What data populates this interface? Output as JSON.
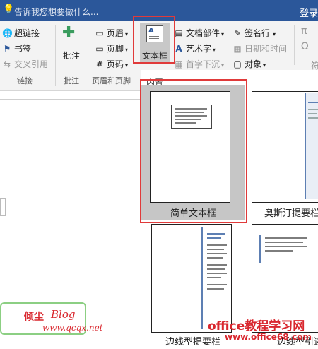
{
  "title_bar": {
    "tell_me_placeholder": "告诉我您想要做什么...",
    "login": "登录"
  },
  "ribbon": {
    "links_group": {
      "items": [
        "超链接",
        "书签",
        "交叉引用"
      ],
      "label": "链接"
    },
    "comments_group": {
      "item": "批注",
      "label": "批注"
    },
    "header_footer_group": {
      "items": [
        "页眉",
        "页脚",
        "页码"
      ],
      "label": "页眉和页脚"
    },
    "text_group": {
      "textbox": "文本框",
      "quick_parts": "文档部件",
      "wordart": "艺术字",
      "drop_cap": "首字下沉",
      "signature_line": "签名行",
      "date_time": "日期和时间",
      "object": "对象"
    },
    "symbols_group": {
      "pi": "π",
      "omega": "Ω",
      "more": "符"
    }
  },
  "gallery": {
    "header": "内置",
    "tiles": [
      {
        "label": "简单文本框",
        "selected": true
      },
      {
        "label": "奥斯汀提要栏",
        "selected": false
      },
      {
        "label": "边线型提要栏",
        "selected": false
      },
      {
        "label": "边线型引述",
        "selected": false
      }
    ]
  },
  "watermarks": {
    "blog_name": "倾尘",
    "blog": "Blog",
    "blog_url": "www.qcqx.net",
    "office_title": "office教程学习网",
    "office_url": "www.office68.com"
  },
  "colors": {
    "title_bar": "#2b579a",
    "highlight": "#e03a3a",
    "watermark_text": "#d9272e"
  }
}
